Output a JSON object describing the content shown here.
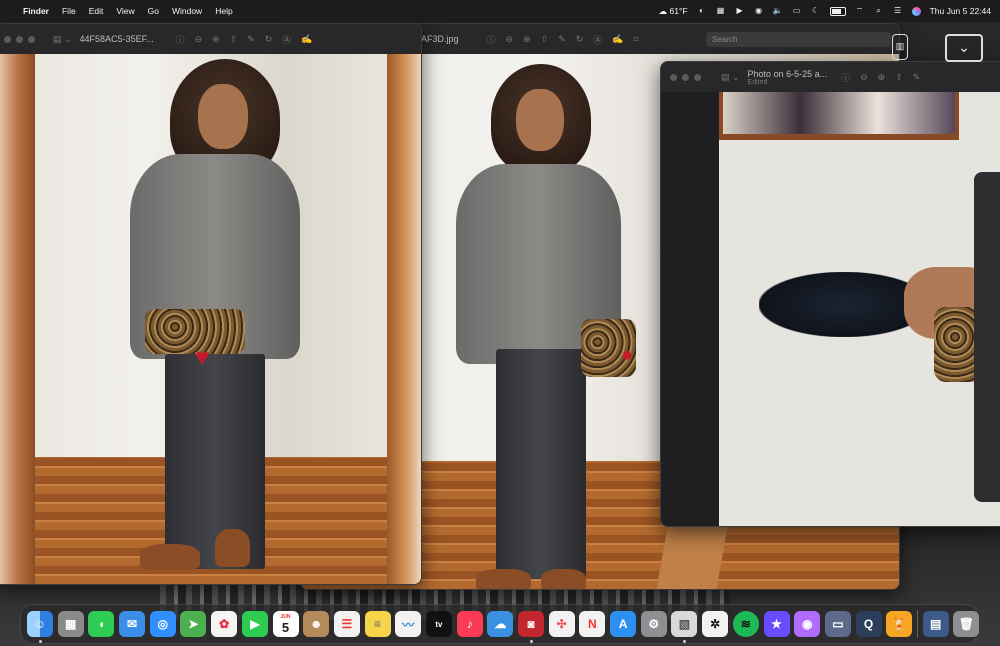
{
  "menubar": {
    "apple_glyph": "",
    "app_name": "Finder",
    "menus": [
      "File",
      "Edit",
      "View",
      "Go",
      "Window",
      "Help"
    ],
    "weather": "61°F",
    "datetime": "Thu Jun 5  22:44"
  },
  "window_left": {
    "title": "44F58AC5-35EF..."
  },
  "window_middle": {
    "title": "AF3D.jpg",
    "search_placeholder": "Search"
  },
  "window_right": {
    "title": "Photo on 6-5-25 a...",
    "subtitle": "Edited"
  },
  "dock": {
    "calendar_month": "JUN",
    "calendar_day": "5",
    "tv_label": "tv",
    "items": [
      {
        "name": "finder",
        "color": "#2f7fe0"
      },
      {
        "name": "launchpad",
        "color": "#8a8a8a"
      },
      {
        "name": "messages",
        "color": "#2ecc52"
      },
      {
        "name": "mail",
        "color": "#3a8ee8"
      },
      {
        "name": "safari",
        "color": "#2f8fff"
      },
      {
        "name": "maps",
        "color": "#4caf50"
      },
      {
        "name": "photos",
        "color": "#f4f4f4"
      },
      {
        "name": "facetime",
        "color": "#2ecc52"
      },
      {
        "name": "calendar",
        "color": "#ffffff"
      },
      {
        "name": "contacts",
        "color": "#b58a5a"
      },
      {
        "name": "reminders",
        "color": "#f2f2f2"
      },
      {
        "name": "notes",
        "color": "#f7d54a"
      },
      {
        "name": "freeform",
        "color": "#f2f2f2"
      },
      {
        "name": "tv",
        "color": "#111111"
      },
      {
        "name": "music",
        "color": "#fa3b55"
      },
      {
        "name": "weather",
        "color": "#3a90e0"
      },
      {
        "name": "photo-booth",
        "color": "#c2262e"
      },
      {
        "name": "pinwheel",
        "color": "#f2f2f2"
      },
      {
        "name": "news",
        "color": "#f2f2f2"
      },
      {
        "name": "app-store",
        "color": "#2d8ff0"
      },
      {
        "name": "system-settings",
        "color": "#8e8e93"
      },
      {
        "name": "preview",
        "color": "#d9d9d9"
      },
      {
        "name": "chatgpt",
        "color": "#f2f2f2"
      },
      {
        "name": "spotify",
        "color": "#1db954"
      },
      {
        "name": "imovie",
        "color": "#6a4cff"
      },
      {
        "name": "podcast",
        "color": "#b26bff"
      },
      {
        "name": "photo-slideshow",
        "color": "#5c6b8a"
      },
      {
        "name": "quicktime",
        "color": "#2c3e5a"
      },
      {
        "name": "cocktail",
        "color": "#f5a623"
      },
      {
        "name": "downloads",
        "color": "#3c5a8a"
      },
      {
        "name": "trash",
        "color": "#8e8e93"
      }
    ]
  }
}
